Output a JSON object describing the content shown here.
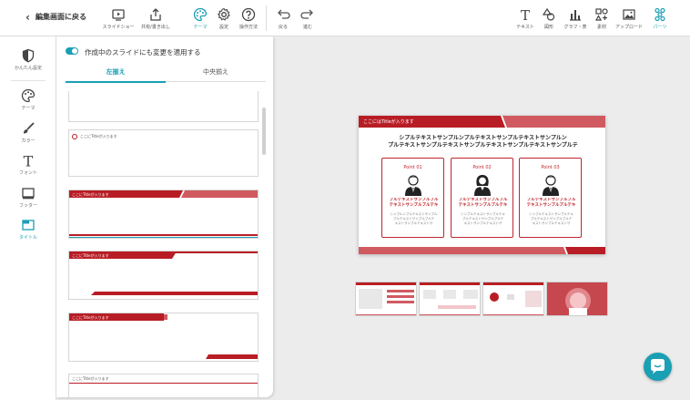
{
  "toolbar": {
    "back_label": "編集画面に戻る",
    "left_items": [
      {
        "label": "スライドショー",
        "icon": "play-icon"
      },
      {
        "label": "共有/書き出し",
        "icon": "share-icon"
      },
      {
        "label": "テーマ",
        "icon": "palette-icon",
        "active": true
      },
      {
        "label": "設定",
        "icon": "gear-icon"
      },
      {
        "label": "操作方法",
        "icon": "help-icon"
      }
    ],
    "history": [
      {
        "label": "戻る",
        "icon": "undo-icon"
      },
      {
        "label": "進む",
        "icon": "redo-icon"
      }
    ],
    "right_items": [
      {
        "label": "テキスト",
        "icon": "text-icon"
      },
      {
        "label": "図形",
        "icon": "shapes-icon"
      },
      {
        "label": "グラフ・表",
        "icon": "chart-icon"
      },
      {
        "label": "素材",
        "icon": "assets-icon"
      },
      {
        "label": "アップロード",
        "icon": "upload-icon"
      },
      {
        "label": "パーツ",
        "icon": "parts-icon",
        "active": true
      }
    ]
  },
  "rail": {
    "items": [
      {
        "label": "かんたん設定",
        "icon": "easy-setup-icon"
      },
      {
        "label": "テーマ",
        "icon": "palette-icon"
      },
      {
        "label": "カラー",
        "icon": "brush-icon"
      },
      {
        "label": "フォント",
        "icon": "font-icon"
      },
      {
        "label": "フッター",
        "icon": "footer-icon"
      },
      {
        "label": "タイトル",
        "icon": "title-icon",
        "active": true
      }
    ]
  },
  "panel": {
    "apply_toggle_label": "作成中のスライドにも変更を適用する",
    "apply_toggle_on": true,
    "tabs": [
      {
        "label": "左揃え",
        "active": true
      },
      {
        "label": "中央揃え",
        "active": false
      }
    ],
    "templates": [
      {
        "title": ""
      },
      {
        "title": "ここにTitleが入ります"
      },
      {
        "title": "ここにTitleが入ります"
      },
      {
        "title": "ここにTitleが入ります"
      },
      {
        "title": "ここにTitleが入ります"
      },
      {
        "title": "ここにTitleが入ります"
      }
    ]
  },
  "slide": {
    "title": "ここにはTitleが入ります",
    "lead_line1": "シプルテキストサンプルンプルテキストサンプルテキストサンプルン",
    "lead_line2": "プルテキストサンプルテキストサンプルテキストサンプルテキストサンプルテ",
    "cards": [
      {
        "point": "Point 01",
        "heading1": "プルテキストサンプルプル",
        "heading2": "テキストサンプルプルテキ",
        "body1": "シンプルンプルテキストサンプル",
        "body2": "プルテキストサンプルプルテ",
        "body3": "キストサンプルテキストサ",
        "person": "male"
      },
      {
        "point": "Point 02",
        "heading1": "プルテキストサンプルプル",
        "heading2": "テキストサンプルプルテキ",
        "body1": "シンプルテキストサンプルテキ",
        "body2": "プルテキストサンプルプルテ",
        "body3": "キストサンプルテキストサ",
        "person": "female"
      },
      {
        "point": "Point 03",
        "heading1": "プルテキストサンプルプル",
        "heading2": "テキストサンプルプルテキ",
        "body1": "シンプルテキストサンプルテキ",
        "body2": "プルテキストサンプルプルテ",
        "body3": "キストサンプルテキストサ",
        "person": "male"
      }
    ]
  },
  "colors": {
    "accent": "#1a9fb4",
    "brand_red": "#b81d25",
    "brand_red_light": "#d05a60"
  },
  "chat_icon": "chat-bubble-icon"
}
